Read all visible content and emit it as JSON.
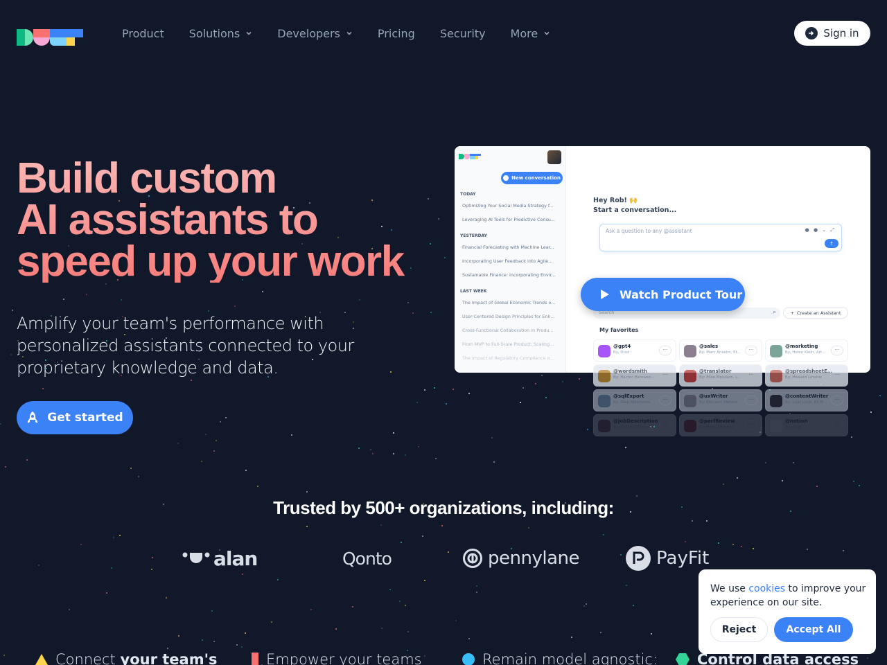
{
  "nav": {
    "brand": "Dust",
    "items": [
      {
        "label": "Product",
        "dropdown": false
      },
      {
        "label": "Solutions",
        "dropdown": true
      },
      {
        "label": "Developers",
        "dropdown": true
      },
      {
        "label": "Pricing",
        "dropdown": false
      },
      {
        "label": "Security",
        "dropdown": false
      },
      {
        "label": "More",
        "dropdown": true
      }
    ],
    "sign_in": "Sign in"
  },
  "hero": {
    "title_lines": [
      "Build custom",
      "AI assistants to",
      "speed up your work"
    ],
    "subtitle": "Amplify your team's performance with personalized assistants connected to your proprietary knowledge and data.",
    "cta": "Get started"
  },
  "preview": {
    "new_conversation": "New conversation",
    "sections": [
      {
        "label": "TODAY",
        "items": [
          "Optimizing Your Social Media Strategy f...",
          "Leveraging AI Tools for Predictive Consu..."
        ]
      },
      {
        "label": "YESTERDAY",
        "items": [
          "Financial Forecasting with Machine Lear...",
          "Incorporating User Feedback into Agile...",
          "Sustainable Finance: Incorporating Envir..."
        ]
      },
      {
        "label": "LAST WEEK",
        "items": [
          "The Impact of Global Economic Trends o...",
          "User-Centered Design Principles for Enh...",
          "Cross-Functional Collaboration in Produ...",
          "From MVP to Full-Scale Product: Scaling...",
          "The Impact of Regulatory Compliance o..."
        ]
      }
    ],
    "greeting": "Hey Rob! 🙌",
    "greeting_sub": "Start a conversation...",
    "input_placeholder": "Ask a question to any @assistant",
    "search_placeholder": "Search",
    "create_assistant": "Create an Assistant",
    "favorites_label": "My favorites",
    "assistants": [
      {
        "name": "@gpt4",
        "by": "By: Dust",
        "color": "#a855f7"
      },
      {
        "name": "@sales",
        "by": "By: Marc Anselm, Et...",
        "color": "#8b7f8f"
      },
      {
        "name": "@marketing",
        "by": "By: Helen Klein, Art...",
        "color": "#7aa39a"
      },
      {
        "name": "@wordsmith",
        "by": "By: Hector Hernand...",
        "color": "#b8862b"
      },
      {
        "name": "@translator",
        "by": "By: Elise Moudern, L...",
        "color": "#b63a3a"
      },
      {
        "name": "@spreadsheetEx...",
        "by": "By: Howard Limons",
        "color": "#c0625a"
      },
      {
        "name": "@sqlExport",
        "by": "By: Olup Nikoltsens",
        "color": "#6b8aa8"
      },
      {
        "name": "@uxWriter",
        "by": "By: Edouard Walters",
        "color": "#8a8a9a"
      },
      {
        "name": "@contentWriter",
        "by": "By: Louz Linut, Eli M...",
        "color": "#2b2f36"
      },
      {
        "name": "@jobDescription",
        "by": "By: DeTonis Poulard",
        "color": "#6b3b4a"
      },
      {
        "name": "@perfReview",
        "by": "By: Henri Doubles",
        "color": "#8b2b35"
      },
      {
        "name": "@notion",
        "by": "By: Dust",
        "color": "#e5e7eb"
      }
    ],
    "watch_tour": "Watch Product Tour"
  },
  "trusted": {
    "title": "Trusted by 500+ organizations, including:",
    "brands": [
      "alan",
      "Qonto",
      "pennylane",
      "PayFit"
    ]
  },
  "features": [
    {
      "regular": "Connect ",
      "bold": "your team's",
      "color": "#fcd34d",
      "shape": "triangle"
    },
    {
      "regular": "Empower your teams",
      "bold": "",
      "color": "#f87171",
      "shape": "bar"
    },
    {
      "regular": "Remain model agnostic:",
      "bold": "",
      "color": "#38bdf8",
      "shape": "circle"
    },
    {
      "regular": "",
      "bold": "Control data access",
      "color": "#34d399",
      "shape": "hexagon"
    }
  ],
  "cookie": {
    "text_before": "We use ",
    "link": "cookies",
    "text_after": " to improve your experience on our site.",
    "reject": "Reject",
    "accept": "Accept All"
  }
}
